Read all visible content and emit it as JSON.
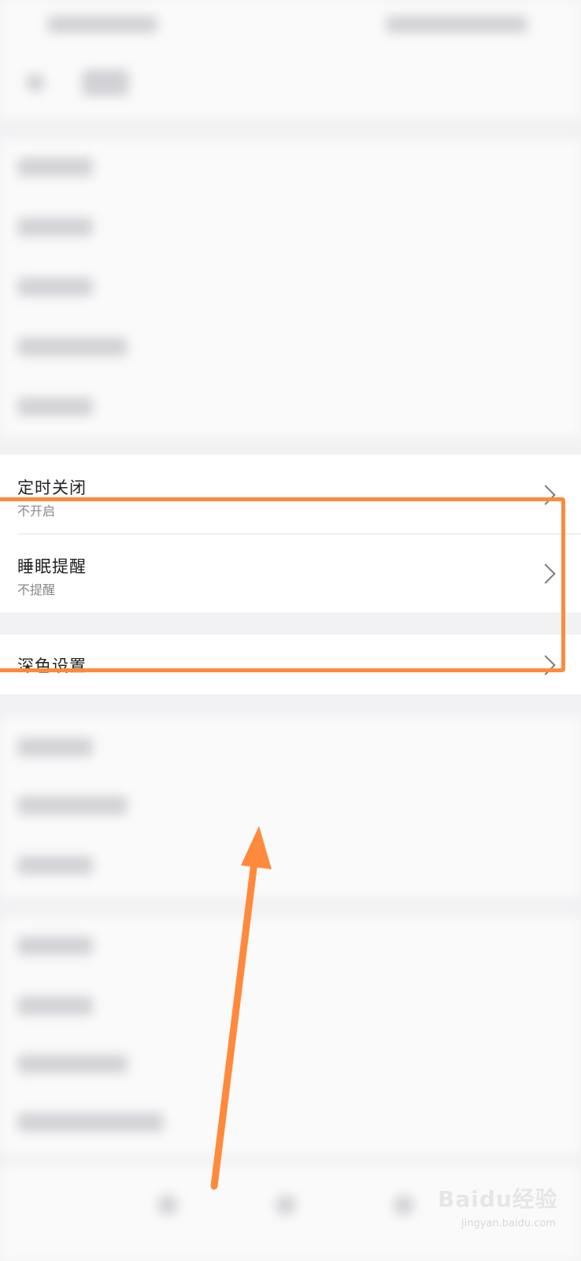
{
  "settings": {
    "timer_close": {
      "title": "定时关闭",
      "subtitle": "不开启"
    },
    "sleep_reminder": {
      "title": "睡眠提醒",
      "subtitle": "不提醒"
    },
    "dark_mode": {
      "title": "深色设置"
    }
  },
  "annotation": {
    "color": "#ff8a3c"
  },
  "watermark": {
    "brand": "Baidu经验",
    "url": "jingyan.baidu.com"
  }
}
